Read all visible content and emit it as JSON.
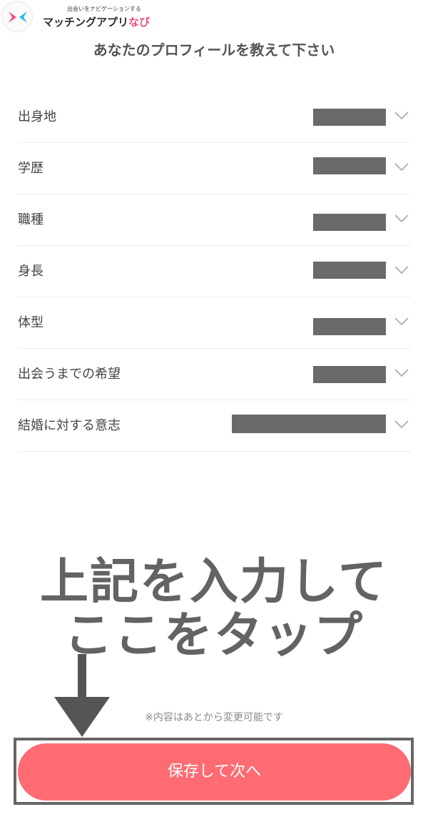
{
  "header": {
    "tagline": "出会いをナビゲーションする",
    "app_name_main": "マッチングアプリ",
    "app_name_accent": "なび",
    "logo_icon": "matching-navi-logo-icon",
    "accent_color": "#ef4f7a"
  },
  "page_title": "あなたのプロフィールを教えて下さい",
  "form": {
    "rows": [
      {
        "label": "出身地",
        "value_redacted": true
      },
      {
        "label": "学歴",
        "value_redacted": true
      },
      {
        "label": "職種",
        "value_redacted": true
      },
      {
        "label": "身長",
        "value_redacted": true
      },
      {
        "label": "体型",
        "value_redacted": true
      },
      {
        "label": "出会うまでの希望",
        "value_redacted": true
      },
      {
        "label": "結婚に対する意志",
        "value_redacted": true
      }
    ],
    "row_icon": "chevron-down-icon"
  },
  "overlay": {
    "line1": "上記を入力して",
    "line2": "ここをタップ",
    "arrow_icon": "arrow-down-icon"
  },
  "note": "※内容はあとから変更可能です",
  "save_button": {
    "label": "保存して次へ",
    "color": "#ff6b72"
  }
}
